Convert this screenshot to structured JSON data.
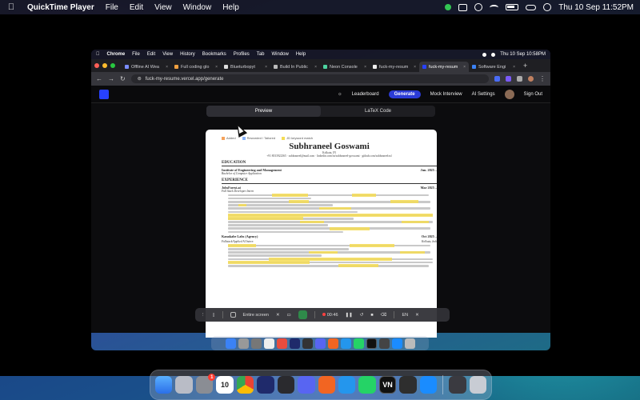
{
  "menubar": {
    "app_name": "QuickTime Player",
    "items": [
      "File",
      "Edit",
      "View",
      "Window",
      "Help"
    ],
    "datetime": "Thu 10 Sep  11:52PM"
  },
  "inner_menubar": {
    "app_name": "Chrome",
    "items": [
      "File",
      "Edit",
      "View",
      "History",
      "Bookmarks",
      "Profiles",
      "Tab",
      "Window",
      "Help"
    ],
    "datetime": "Thu 10 Sep  10:58PM"
  },
  "tabs": [
    {
      "label": "Offline AI Wea"
    },
    {
      "label": "Full coding glo"
    },
    {
      "label": "Blueturbopyt"
    },
    {
      "label": "Build In Public"
    },
    {
      "label": "Neon Console"
    },
    {
      "label": "fuck-my-resum"
    },
    {
      "label": "fuck-my-resum"
    },
    {
      "label": "Software Engi"
    }
  ],
  "address": {
    "url": "fuck-my-resume.vercel.app/generate"
  },
  "appbar": {
    "leaderboard": "Leaderboard",
    "generate": "Generate",
    "mock_interview": "Mock Interview",
    "ai_settings": "AI Settings",
    "sign_out": "Sign Out"
  },
  "view_toggle": {
    "preview": "Preview",
    "latex": "LaTeX Code"
  },
  "resume": {
    "legend": [
      "Added",
      "Reworded / Tailored",
      "JD keyword match"
    ],
    "name": "Subhraneel Goswami",
    "location": "Kolkata, IN",
    "contact": "+91 8013922365 · subhraneel@mail.com · linkedin.com/in/subhraneel-goswami · github.com/subhraneelxsf",
    "sections": {
      "education": "EDUCATION",
      "experience": "EXPERIENCE"
    },
    "edu_school": "Institute of Engineering and Management",
    "edu_date": "Jun. 2025 –",
    "edu_degree": "Bachelor of Computer Application",
    "job1_company": "JobsForest.ai",
    "job1_date": "Mar 2025 –",
    "job1_role": "Full Stack Developer Intern",
    "job2_company": "Kanakabe Labs (Agency)",
    "job2_date": "Oct 2025 –",
    "job2_role": "Fullstack/Applied AI Intern",
    "job2_loc": "Kolkata, Indi"
  },
  "recording_bar": {
    "entire_screen": "Entire screen",
    "timer": "00:46",
    "lang": "EN"
  },
  "dock_badge": "1",
  "dock_calendar_day": "10",
  "dock_vn": "VN",
  "colors": {
    "highlight_yellow": "#f4dc55",
    "added_orange": "#f5a25c",
    "reworded_blue": "#8ab4f8",
    "brand_blue": "#2741ff"
  }
}
